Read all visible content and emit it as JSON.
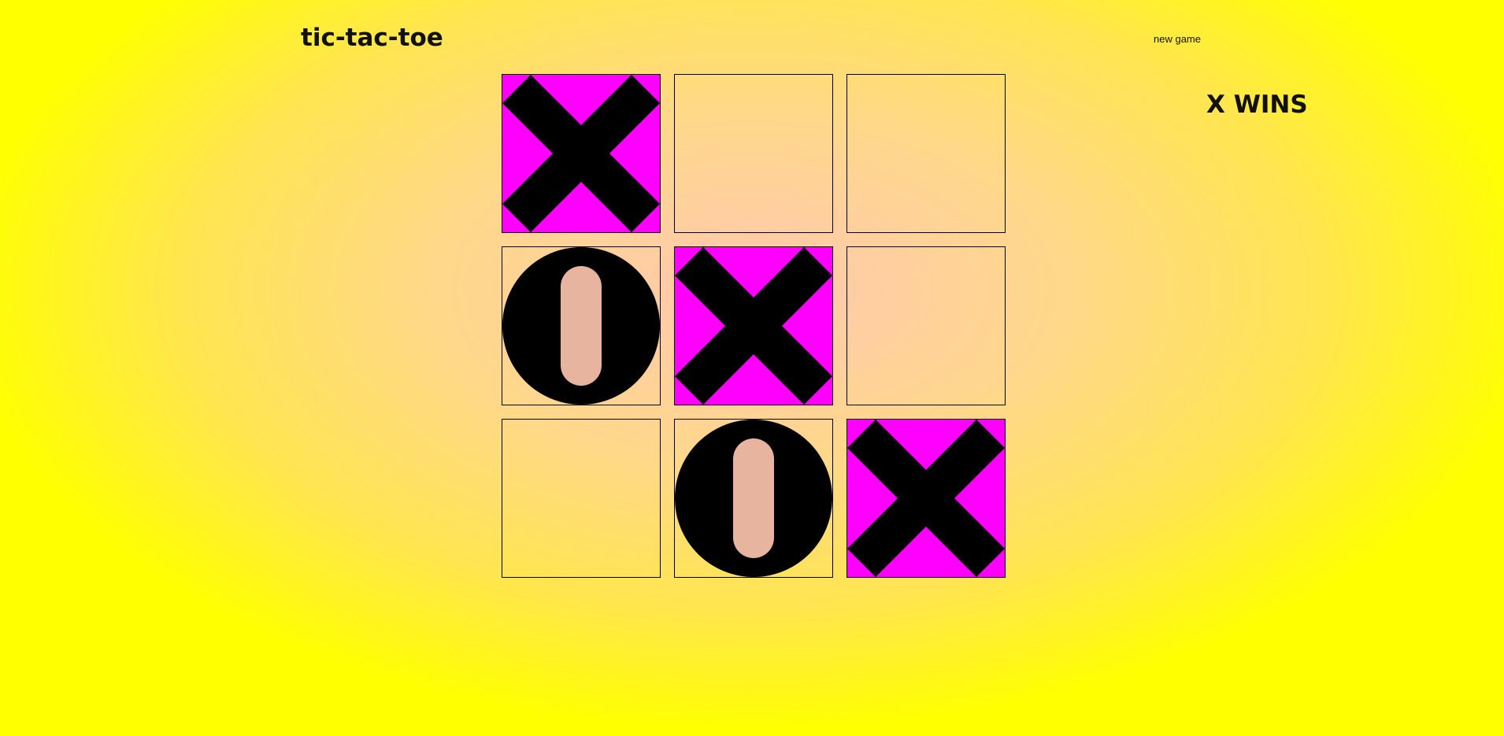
{
  "header": {
    "title": "tic-tac-toe",
    "new_game_label": "new game"
  },
  "status": {
    "text": "X WINS"
  },
  "board": {
    "cells": [
      "X",
      "",
      "",
      "O",
      "X",
      "",
      "",
      "O",
      "X"
    ],
    "winning_cells": [
      0,
      4,
      8
    ]
  },
  "colors": {
    "win_highlight": "#ff00ff",
    "mark": "#000000",
    "background_center": "#ffc8b0",
    "background_edge": "#ffff00"
  },
  "icons": {
    "X": "x-mark-icon",
    "O": "o-mark-icon"
  }
}
